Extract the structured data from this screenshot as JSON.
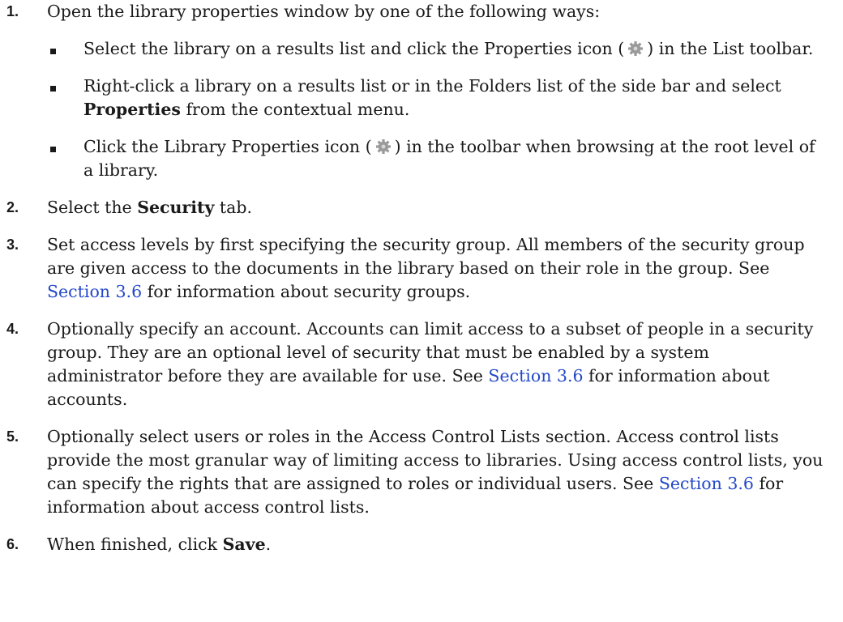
{
  "steps": [
    {
      "number": "1.",
      "text": "Open the library properties window by one of the following ways:",
      "bullets": [
        {
          "before": "Select the library on a results list and click the Properties icon (",
          "after": ") in the List toolbar.",
          "icon": "gear-icon"
        },
        {
          "before": "Right-click a library on a results list or in the Folders list of the side bar and select ",
          "bold": "Properties",
          "after": " from the contextual menu."
        },
        {
          "before": "Click the Library Properties icon (",
          "after": ") in the toolbar when browsing at the root level of a library.",
          "icon": "gear-icon"
        }
      ]
    },
    {
      "number": "2.",
      "before": "Select the ",
      "bold": "Security",
      "after": " tab."
    },
    {
      "number": "3.",
      "before": "Set access levels by first specifying the security group. All members of the security group are given access to the documents in the library based on their role in the group. See ",
      "link": "Section 3.6",
      "after": " for information about security groups."
    },
    {
      "number": "4.",
      "before": "Optionally specify an account. Accounts can limit access to a subset of people in a security group. They are an optional level of security that must be enabled by a system administrator before they are available for use. See ",
      "link": "Section 3.6",
      "after": " for information about accounts."
    },
    {
      "number": "5.",
      "before": "Optionally select users or roles in the Access Control Lists section. Access control lists provide the most granular way of limiting access to libraries. Using access control lists, you can specify the rights that are assigned to roles or individual users. See ",
      "link": "Section 3.6",
      "after": " for information about access control lists."
    },
    {
      "number": "6.",
      "before": "When finished, click ",
      "bold": "Save",
      "after": "."
    }
  ],
  "colors": {
    "text": "#1a1a1a",
    "link": "#2448c8",
    "icon": "#9a9a9a"
  }
}
